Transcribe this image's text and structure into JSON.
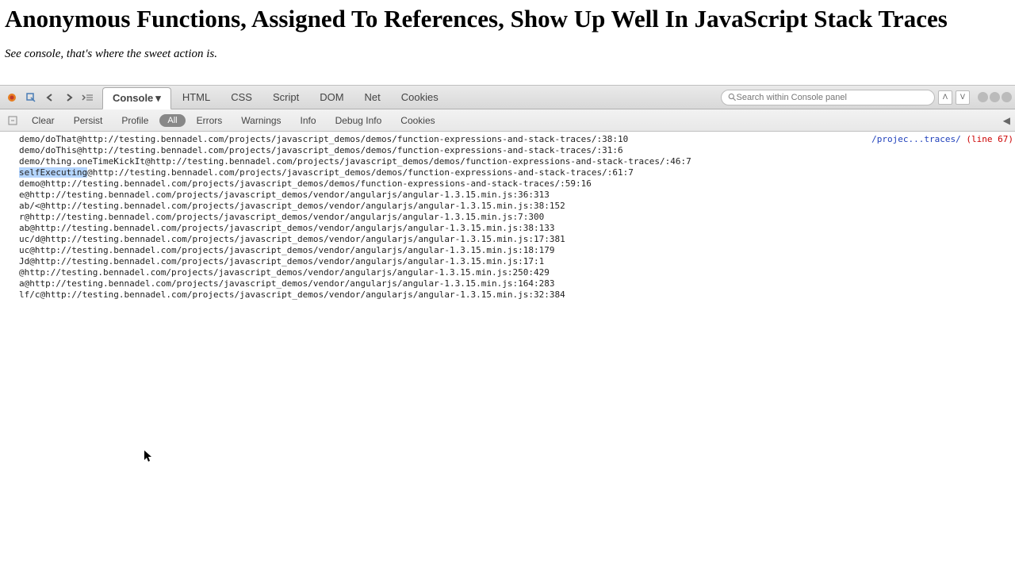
{
  "page": {
    "title": "Anonymous Functions, Assigned To References, Show Up Well In JavaScript Stack Traces",
    "subtitle": "See console, that's where the sweet action is."
  },
  "toolbar": {
    "tabs": [
      "Console",
      "HTML",
      "CSS",
      "Script",
      "DOM",
      "Net",
      "Cookies"
    ],
    "active_tab": "Console",
    "search_placeholder": "Search within Console panel"
  },
  "subtoolbar": {
    "clear": "Clear",
    "persist": "Persist",
    "profile": "Profile",
    "filters": [
      "All",
      "Errors",
      "Warnings",
      "Info",
      "Debug Info",
      "Cookies"
    ],
    "active_filter": "All"
  },
  "console": {
    "source_path": "/projec...traces/",
    "source_line": "(line 67)",
    "trace": [
      "demo/doThat@http://testing.bennadel.com/projects/javascript_demos/demos/function-expressions-and-stack-traces/:38:10",
      "demo/doThis@http://testing.bennadel.com/projects/javascript_demos/demos/function-expressions-and-stack-traces/:31:6",
      "demo/thing.oneTimeKickIt@http://testing.bennadel.com/projects/javascript_demos/demos/function-expressions-and-stack-traces/:46:7",
      "selfExecuting@http://testing.bennadel.com/projects/javascript_demos/demos/function-expressions-and-stack-traces/:61:7",
      "demo@http://testing.bennadel.com/projects/javascript_demos/demos/function-expressions-and-stack-traces/:59:16",
      "e@http://testing.bennadel.com/projects/javascript_demos/vendor/angularjs/angular-1.3.15.min.js:36:313",
      "ab/<@http://testing.bennadel.com/projects/javascript_demos/vendor/angularjs/angular-1.3.15.min.js:38:152",
      "r@http://testing.bennadel.com/projects/javascript_demos/vendor/angularjs/angular-1.3.15.min.js:7:300",
      "ab@http://testing.bennadel.com/projects/javascript_demos/vendor/angularjs/angular-1.3.15.min.js:38:133",
      "uc/d@http://testing.bennadel.com/projects/javascript_demos/vendor/angularjs/angular-1.3.15.min.js:17:381",
      "uc@http://testing.bennadel.com/projects/javascript_demos/vendor/angularjs/angular-1.3.15.min.js:18:179",
      "Jd@http://testing.bennadel.com/projects/javascript_demos/vendor/angularjs/angular-1.3.15.min.js:17:1",
      "@http://testing.bennadel.com/projects/javascript_demos/vendor/angularjs/angular-1.3.15.min.js:250:429",
      "a@http://testing.bennadel.com/projects/javascript_demos/vendor/angularjs/angular-1.3.15.min.js:164:283",
      "lf/c@http://testing.bennadel.com/projects/javascript_demos/vendor/angularjs/angular-1.3.15.min.js:32:384"
    ],
    "highlighted_index": 3,
    "highlighted_text": "selfExecuting"
  }
}
